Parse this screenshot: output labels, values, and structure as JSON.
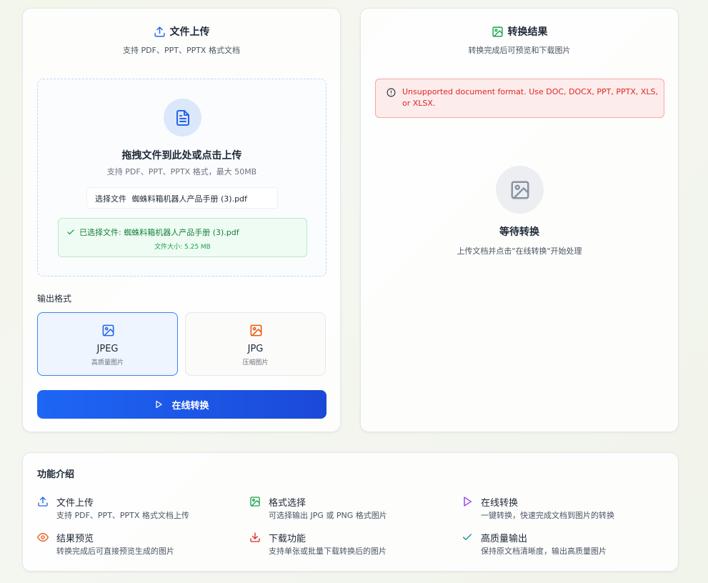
{
  "colors": {
    "primary": "#1e66f5",
    "success": "#16a34a",
    "error": "#dc2626",
    "orange": "#ea580c",
    "purple": "#9333ea",
    "teal": "#0d9488"
  },
  "upload": {
    "title": "文件上传",
    "subtitle": "支持 PDF、PPT、PPTX 格式文档",
    "icon": "upload-icon",
    "dropzone": {
      "icon": "document-icon",
      "title": "拖拽文件到此处或点击上传",
      "hint": "支持 PDF、PPT、PPTX 格式，最大 50MB",
      "file_button_label": "选择文件",
      "file_name": "蜘蛛料箱机器人产品手册 (3).pdf"
    },
    "selected": {
      "label": "已选择文件: 蜘蛛料箱机器人产品手册 (3).pdf",
      "size": "文件大小: 5.25 MB"
    },
    "output_format_label": "输出格式",
    "formats": [
      {
        "name": "JPEG",
        "desc": "高质量图片",
        "selected": true
      },
      {
        "name": "JPG",
        "desc": "压缩图片",
        "selected": false
      }
    ],
    "convert_button": "在线转换"
  },
  "result": {
    "title": "转换结果",
    "subtitle": "转换完成后可预览和下载图片",
    "icon": "image-icon",
    "error": "Unsupported document format. Use DOC, DOCX, PPT, PPTX, XLS, or XLSX.",
    "waiting_title": "等待转换",
    "waiting_sub": "上传文档并点击\"在线转换\"开始处理"
  },
  "features": {
    "title": "功能介绍",
    "items": [
      {
        "icon": "upload-icon",
        "name": "文件上传",
        "desc": "支持 PDF、PPT、PPTX 格式文档上传"
      },
      {
        "icon": "image-icon",
        "name": "格式选择",
        "desc": "可选择输出 JPG 或 PNG 格式图片"
      },
      {
        "icon": "play-icon",
        "name": "在线转换",
        "desc": "一键转换，快速完成文档到图片的转换"
      },
      {
        "icon": "eye-icon",
        "name": "结果预览",
        "desc": "转换完成后可直接预览生成的图片"
      },
      {
        "icon": "download-icon",
        "name": "下载功能",
        "desc": "支持单张或批量下载转换后的图片"
      },
      {
        "icon": "check-icon",
        "name": "高质量输出",
        "desc": "保持原文档清晰度，输出高质量图片"
      }
    ]
  }
}
